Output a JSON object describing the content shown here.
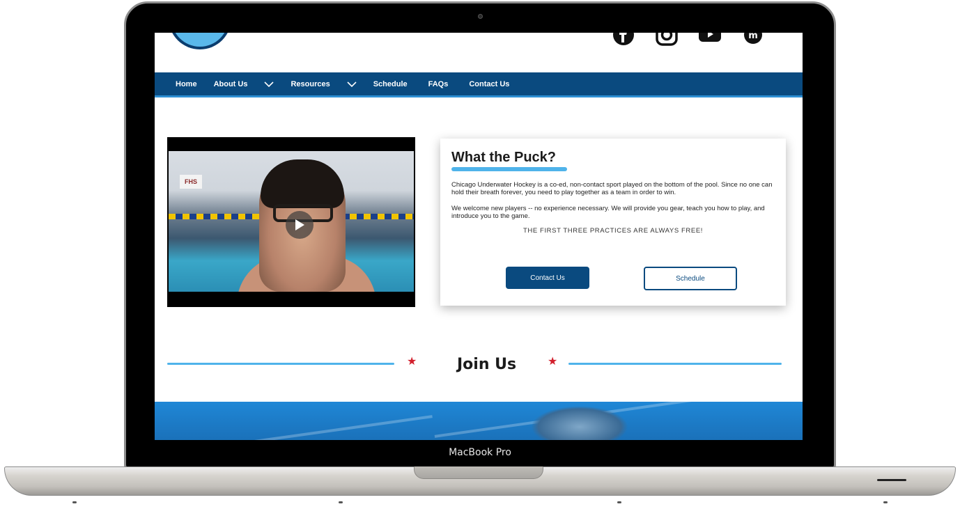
{
  "device": {
    "label": "MacBook Pro"
  },
  "nav": {
    "items": [
      {
        "label": "Home",
        "has_dropdown": false
      },
      {
        "label": "About Us",
        "has_dropdown": true
      },
      {
        "label": "Resources",
        "has_dropdown": true
      },
      {
        "label": "Schedule",
        "has_dropdown": false
      },
      {
        "label": "FAQs",
        "has_dropdown": false
      },
      {
        "label": "Contact Us",
        "has_dropdown": false
      }
    ]
  },
  "social_icons": [
    "facebook-icon",
    "instagram-icon",
    "youtube-icon",
    "meetup-icon"
  ],
  "video": {
    "sign_text": "FHS"
  },
  "card": {
    "title": "What the Puck?",
    "paragraph1": "Chicago Underwater Hockey is a co-ed, non-contact sport played on the bottom of the pool. Since no one can hold their breath forever, you need to play together as a team in order to win.",
    "paragraph2": "We welcome new players -- no experience necessary. We will provide you gear, teach you how to play, and introduce you to the game.",
    "free_note": "THE FIRST THREE PRACTICES ARE ALWAYS FREE!",
    "contact_button": "Contact Us",
    "schedule_button": "Schedule"
  },
  "join": {
    "title": "Join Us",
    "star_glyph": "★"
  },
  "colors": {
    "nav_bg": "#0a4a7f",
    "accent": "#4fb3ea",
    "star": "#d21f2c"
  }
}
